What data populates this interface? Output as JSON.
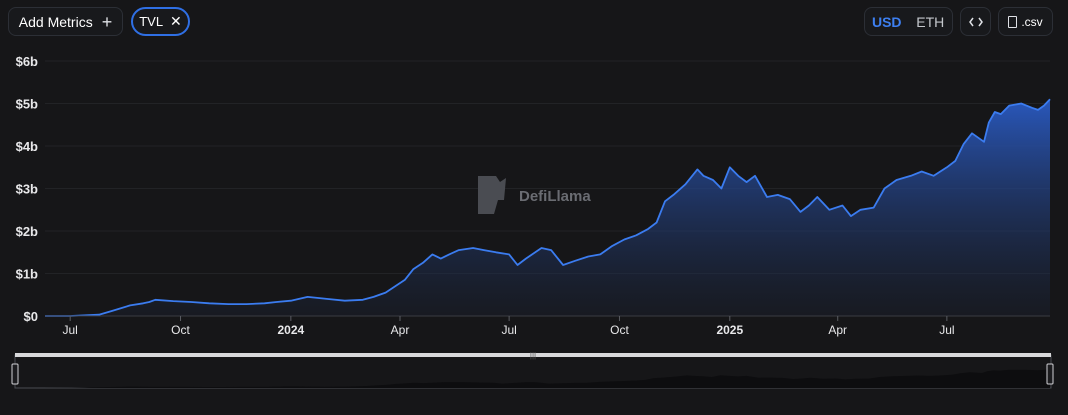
{
  "toolbar": {
    "add_metrics_label": "Add Metrics",
    "add_icon": "plus-icon",
    "metric_chip_label": "TVL",
    "chip_close_icon": "close-icon",
    "currency_options": [
      "USD",
      "ETH"
    ],
    "currency_selected": "USD",
    "embed_icon": "code-icon",
    "csv_label": ".csv",
    "csv_icon": "file-icon"
  },
  "watermark": {
    "text": "DefiLlama",
    "icon": "llama-logo-icon"
  },
  "colors": {
    "background": "#161618",
    "line": "#3b7cf0",
    "accent": "#2f6fe4",
    "area_top": "#2a5bc4"
  },
  "chart_data": {
    "type": "area",
    "title": "",
    "xlabel": "",
    "ylabel": "",
    "y_unit": "USD",
    "ylim": [
      0,
      6000000000
    ],
    "y_ticks": [
      "$0",
      "$1b",
      "$2b",
      "$3b",
      "$4b",
      "$5b",
      "$6b"
    ],
    "x_ticks": [
      {
        "date": "2023-07-01",
        "label": "Jul",
        "bold": false
      },
      {
        "date": "2023-10-01",
        "label": "Oct",
        "bold": false
      },
      {
        "date": "2024-01-01",
        "label": "2024",
        "bold": true
      },
      {
        "date": "2024-04-01",
        "label": "Apr",
        "bold": false
      },
      {
        "date": "2024-07-01",
        "label": "Jul",
        "bold": false
      },
      {
        "date": "2024-10-01",
        "label": "Oct",
        "bold": false
      },
      {
        "date": "2025-01-01",
        "label": "2025",
        "bold": true
      },
      {
        "date": "2025-04-01",
        "label": "Apr",
        "bold": false
      },
      {
        "date": "2025-07-01",
        "label": "Jul",
        "bold": false
      }
    ],
    "xlim": [
      "2023-06-10",
      "2025-09-25"
    ],
    "grid": true,
    "legend": "none",
    "series": [
      {
        "name": "TVL",
        "x": [
          "2023-06-10",
          "2023-07-01",
          "2023-07-25",
          "2023-08-05",
          "2023-08-20",
          "2023-08-31",
          "2023-09-05",
          "2023-09-10",
          "2023-09-25",
          "2023-10-10",
          "2023-10-25",
          "2023-11-10",
          "2023-11-25",
          "2023-12-10",
          "2023-12-20",
          "2024-01-01",
          "2024-01-15",
          "2024-02-01",
          "2024-02-15",
          "2024-03-01",
          "2024-03-10",
          "2024-03-20",
          "2024-03-28",
          "2024-04-05",
          "2024-04-12",
          "2024-04-20",
          "2024-04-28",
          "2024-05-05",
          "2024-05-12",
          "2024-05-20",
          "2024-06-01",
          "2024-06-10",
          "2024-06-20",
          "2024-07-01",
          "2024-07-08",
          "2024-07-15",
          "2024-07-28",
          "2024-08-05",
          "2024-08-15",
          "2024-08-25",
          "2024-09-05",
          "2024-09-15",
          "2024-09-25",
          "2024-10-05",
          "2024-10-15",
          "2024-10-25",
          "2024-11-01",
          "2024-11-08",
          "2024-11-15",
          "2024-11-25",
          "2024-12-05",
          "2024-12-10",
          "2024-12-18",
          "2024-12-25",
          "2025-01-01",
          "2025-01-08",
          "2025-01-15",
          "2025-01-22",
          "2025-02-01",
          "2025-02-10",
          "2025-02-20",
          "2025-03-01",
          "2025-03-08",
          "2025-03-15",
          "2025-03-25",
          "2025-04-05",
          "2025-04-12",
          "2025-04-20",
          "2025-05-01",
          "2025-05-10",
          "2025-05-20",
          "2025-06-01",
          "2025-06-10",
          "2025-06-20",
          "2025-07-01",
          "2025-07-08",
          "2025-07-15",
          "2025-07-22",
          "2025-08-01",
          "2025-08-05",
          "2025-08-10",
          "2025-08-15",
          "2025-08-22",
          "2025-09-01",
          "2025-09-10",
          "2025-09-15",
          "2025-09-20",
          "2025-09-25"
        ],
        "y": [
          0,
          0,
          30000000.0,
          120000000.0,
          250000000.0,
          300000000.0,
          330000000.0,
          380000000.0,
          350000000.0,
          330000000.0,
          300000000.0,
          280000000.0,
          280000000.0,
          300000000.0,
          330000000.0,
          360000000.0,
          450000000.0,
          400000000.0,
          360000000.0,
          380000000.0,
          450000000.0,
          550000000.0,
          700000000.0,
          850000000.0,
          1100000000.0,
          1250000000.0,
          1450000000.0,
          1350000000.0,
          1450000000.0,
          1550000000.0,
          1600000000.0,
          1550000000.0,
          1500000000.0,
          1450000000.0,
          1200000000.0,
          1350000000.0,
          1600000000.0,
          1550000000.0,
          1200000000.0,
          1300000000.0,
          1400000000.0,
          1450000000.0,
          1650000000.0,
          1800000000.0,
          1900000000.0,
          2050000000.0,
          2200000000.0,
          2700000000.0,
          2850000000.0,
          3100000000.0,
          3450000000.0,
          3300000000.0,
          3200000000.0,
          3000000000.0,
          3500000000.0,
          3300000000.0,
          3150000000.0,
          3300000000.0,
          2800000000.0,
          2850000000.0,
          2750000000.0,
          2450000000.0,
          2600000000.0,
          2800000000.0,
          2500000000.0,
          2600000000.0,
          2350000000.0,
          2500000000.0,
          2550000000.0,
          3000000000.0,
          3200000000.0,
          3300000000.0,
          3400000000.0,
          3300000000.0,
          3500000000.0,
          3650000000.0,
          4050000000.0,
          4300000000.0,
          4100000000.0,
          4550000000.0,
          4800000000.0,
          4750000000.0,
          4950000000.0,
          5000000000.0,
          4900000000.0,
          4850000000.0,
          4950000000.0,
          5100000000.0
        ]
      }
    ]
  }
}
